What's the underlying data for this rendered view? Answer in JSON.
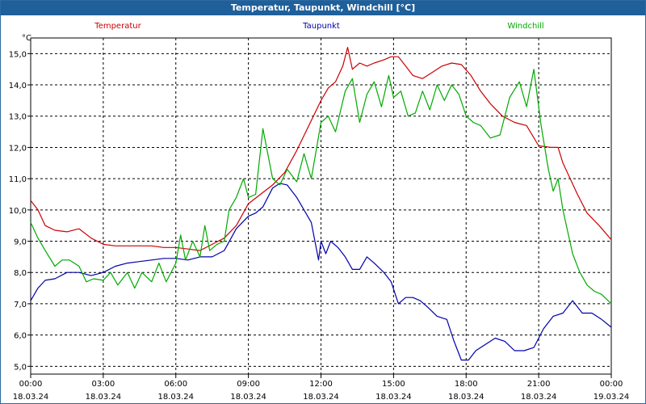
{
  "window": {
    "title": "Temperatur, Taupunkt, Windchill [°C]"
  },
  "chart_data": {
    "type": "line",
    "unit_label": "°C",
    "ylim": [
      4.75,
      15.5
    ],
    "xlim": [
      0,
      24
    ],
    "grid": true,
    "y_ticks": [
      {
        "value": 5.0,
        "label": "5,0"
      },
      {
        "value": 6.0,
        "label": "6,0"
      },
      {
        "value": 7.0,
        "label": "7,0"
      },
      {
        "value": 8.0,
        "label": "8,0"
      },
      {
        "value": 9.0,
        "label": "9,0"
      },
      {
        "value": 10.0,
        "label": "10,0"
      },
      {
        "value": 11.0,
        "label": "11,0"
      },
      {
        "value": 12.0,
        "label": "12,0"
      },
      {
        "value": 13.0,
        "label": "13,0"
      },
      {
        "value": 14.0,
        "label": "14,0"
      },
      {
        "value": 15.0,
        "label": "15,0"
      }
    ],
    "x_ticks": [
      {
        "value": 0,
        "time": "00:00",
        "date": "18.03.24"
      },
      {
        "value": 3,
        "time": "03:00",
        "date": "18.03.24"
      },
      {
        "value": 6,
        "time": "06:00",
        "date": "18.03.24"
      },
      {
        "value": 9,
        "time": "09:00",
        "date": "18.03.24"
      },
      {
        "value": 12,
        "time": "12:00",
        "date": "18.03.24"
      },
      {
        "value": 15,
        "time": "15:00",
        "date": "18.03.24"
      },
      {
        "value": 18,
        "time": "18:00",
        "date": "18.03.24"
      },
      {
        "value": 21,
        "time": "21:00",
        "date": "18.03.24"
      },
      {
        "value": 24,
        "time": "00:00",
        "date": "19.03.24"
      }
    ],
    "series": [
      {
        "name": "Temperatur",
        "color": "#cc0000",
        "legend_position": "left",
        "x": [
          0,
          0.3,
          0.6,
          1,
          1.5,
          2,
          2.5,
          3,
          3.5,
          4,
          4.5,
          5,
          5.5,
          6,
          6.5,
          7,
          7.5,
          8,
          8.5,
          9,
          9.5,
          10,
          10.5,
          11,
          11.5,
          12,
          12.3,
          12.6,
          12.9,
          13.1,
          13.3,
          13.6,
          13.9,
          14.2,
          14.6,
          14.9,
          15.2,
          15.5,
          15.8,
          16.2,
          16.6,
          17,
          17.4,
          17.8,
          18.2,
          18.6,
          19,
          19.5,
          20,
          20.5,
          21,
          21.5,
          21.8,
          22,
          22.3,
          22.6,
          23,
          23.5,
          24
        ],
        "y": [
          10.3,
          10.0,
          9.5,
          9.35,
          9.3,
          9.4,
          9.1,
          8.9,
          8.85,
          8.85,
          8.85,
          8.85,
          8.8,
          8.8,
          8.75,
          8.7,
          8.9,
          9.1,
          9.5,
          10.2,
          10.5,
          10.8,
          11.2,
          11.9,
          12.7,
          13.5,
          13.9,
          14.1,
          14.6,
          15.2,
          14.5,
          14.7,
          14.6,
          14.7,
          14.8,
          14.9,
          14.9,
          14.6,
          14.3,
          14.2,
          14.4,
          14.6,
          14.7,
          14.65,
          14.3,
          13.8,
          13.4,
          13.0,
          12.8,
          12.7,
          12.05,
          12.0,
          12.0,
          11.5,
          11.0,
          10.5,
          9.9,
          9.5,
          9.05
        ]
      },
      {
        "name": "Taupunkt",
        "color": "#0000aa",
        "legend_position": "center",
        "x": [
          0,
          0.3,
          0.6,
          1,
          1.5,
          2,
          2.5,
          3,
          3.5,
          4,
          4.5,
          5,
          5.5,
          6,
          6.5,
          7,
          7.5,
          8,
          8.5,
          9,
          9.3,
          9.6,
          10,
          10.3,
          10.6,
          11,
          11.3,
          11.6,
          11.9,
          12,
          12.2,
          12.4,
          12.7,
          13,
          13.3,
          13.6,
          13.9,
          14.2,
          14.6,
          14.9,
          15.2,
          15.5,
          15.8,
          16.1,
          16.4,
          16.8,
          17.2,
          17.5,
          17.8,
          18.1,
          18.4,
          18.8,
          19.2,
          19.6,
          20,
          20.4,
          20.8,
          21.2,
          21.6,
          22,
          22.4,
          22.8,
          23.2,
          23.6,
          24
        ],
        "y": [
          7.1,
          7.5,
          7.75,
          7.8,
          8.0,
          8.0,
          7.9,
          8.0,
          8.2,
          8.3,
          8.35,
          8.4,
          8.45,
          8.45,
          8.4,
          8.5,
          8.5,
          8.7,
          9.4,
          9.8,
          9.9,
          10.1,
          10.7,
          10.85,
          10.8,
          10.4,
          10.0,
          9.6,
          8.4,
          9.0,
          8.6,
          9.0,
          8.8,
          8.5,
          8.1,
          8.1,
          8.5,
          8.3,
          8.0,
          7.7,
          7.0,
          7.2,
          7.2,
          7.1,
          6.9,
          6.6,
          6.5,
          5.8,
          5.2,
          5.2,
          5.5,
          5.7,
          5.9,
          5.8,
          5.5,
          5.5,
          5.6,
          6.2,
          6.6,
          6.7,
          7.1,
          6.7,
          6.7,
          6.5,
          6.25
        ]
      },
      {
        "name": "Windchill",
        "color": "#00aa00",
        "legend_position": "right",
        "x": [
          0,
          0.3,
          0.6,
          1,
          1.3,
          1.6,
          2,
          2.3,
          2.6,
          3,
          3.3,
          3.6,
          4,
          4.3,
          4.6,
          5,
          5.3,
          5.6,
          6,
          6.2,
          6.4,
          6.7,
          7,
          7.2,
          7.4,
          7.7,
          8,
          8.2,
          8.5,
          8.8,
          9,
          9.3,
          9.6,
          10,
          10.3,
          10.6,
          11,
          11.3,
          11.6,
          12,
          12.3,
          12.6,
          13,
          13.3,
          13.6,
          13.9,
          14.2,
          14.5,
          14.8,
          15,
          15.3,
          15.6,
          15.9,
          16.2,
          16.5,
          16.8,
          17.1,
          17.4,
          17.7,
          18,
          18.3,
          18.6,
          19,
          19.4,
          19.8,
          20.2,
          20.5,
          20.8,
          21.1,
          21.4,
          21.6,
          21.8,
          22,
          22.2,
          22.4,
          22.7,
          23,
          23.3,
          23.6,
          24
        ],
        "y": [
          9.6,
          9.1,
          8.7,
          8.2,
          8.4,
          8.4,
          8.2,
          7.7,
          7.8,
          7.75,
          8.0,
          7.6,
          8.0,
          7.5,
          8.0,
          7.7,
          8.3,
          7.7,
          8.3,
          9.2,
          8.4,
          9.0,
          8.5,
          9.5,
          8.7,
          8.9,
          9.0,
          10.0,
          10.4,
          11.0,
          10.4,
          10.5,
          12.6,
          11.0,
          10.8,
          11.3,
          10.9,
          11.8,
          11.0,
          12.8,
          13.0,
          12.5,
          13.8,
          14.2,
          12.8,
          13.7,
          14.1,
          13.3,
          14.3,
          13.6,
          13.8,
          13.0,
          13.1,
          13.8,
          13.2,
          14.0,
          13.5,
          14.0,
          13.7,
          13.0,
          12.8,
          12.7,
          12.3,
          12.4,
          13.6,
          14.1,
          13.3,
          14.5,
          12.7,
          11.3,
          10.6,
          11.0,
          10.0,
          9.3,
          8.6,
          8.0,
          7.6,
          7.4,
          7.3,
          7.0
        ]
      }
    ]
  }
}
